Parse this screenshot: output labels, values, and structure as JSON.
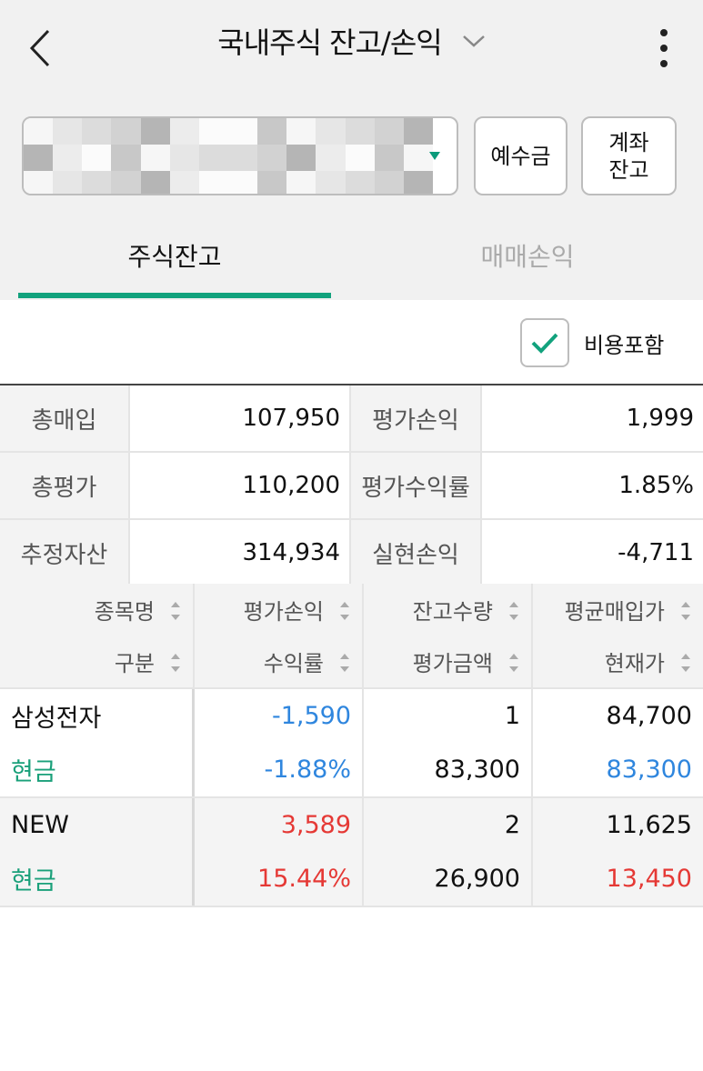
{
  "header": {
    "title": "국내주식 잔고/손익"
  },
  "account": {
    "number_masked": ""
  },
  "buttons": {
    "deposit": "예수금",
    "account_balance_line1": "계좌",
    "account_balance_line2": "잔고"
  },
  "tabs": [
    {
      "label": "주식잔고",
      "active": true
    },
    {
      "label": "매매손익",
      "active": false
    }
  ],
  "fee_toggle": {
    "label": "비용포함",
    "checked": true
  },
  "summary": [
    {
      "label": "총매입",
      "value": "107,950",
      "label2": "평가손익",
      "value2": "1,999",
      "value2_color": "red"
    },
    {
      "label": "총평가",
      "value": "110,200",
      "label2": "평가수익률",
      "value2": "1.85%",
      "value2_color": "red"
    },
    {
      "label": "추정자산",
      "value": "314,934",
      "label2": "실현손익",
      "value2": "-4,711",
      "value2_color": "blue"
    }
  ],
  "columns": {
    "top": [
      "종목명",
      "평가손익",
      "잔고수량",
      "평균매입가"
    ],
    "bottom": [
      "구분",
      "수익률",
      "평가금액",
      "현재가"
    ]
  },
  "holdings": [
    {
      "name": "삼성전자",
      "type": "현금",
      "pnl": "-1,590",
      "return_rate": "-1.88%",
      "quantity": "1",
      "eval_amount": "83,300",
      "avg_price": "84,700",
      "current_price": "83,300",
      "trend": "down"
    },
    {
      "name": "NEW",
      "type": "현금",
      "pnl": "3,589",
      "return_rate": "15.44%",
      "quantity": "2",
      "eval_amount": "26,900",
      "avg_price": "11,625",
      "current_price": "13,450",
      "trend": "up"
    }
  ],
  "colors": {
    "accent": "#12a27d",
    "up": "#e53935",
    "down": "#2f86de",
    "type_text": "#1aa07a"
  }
}
